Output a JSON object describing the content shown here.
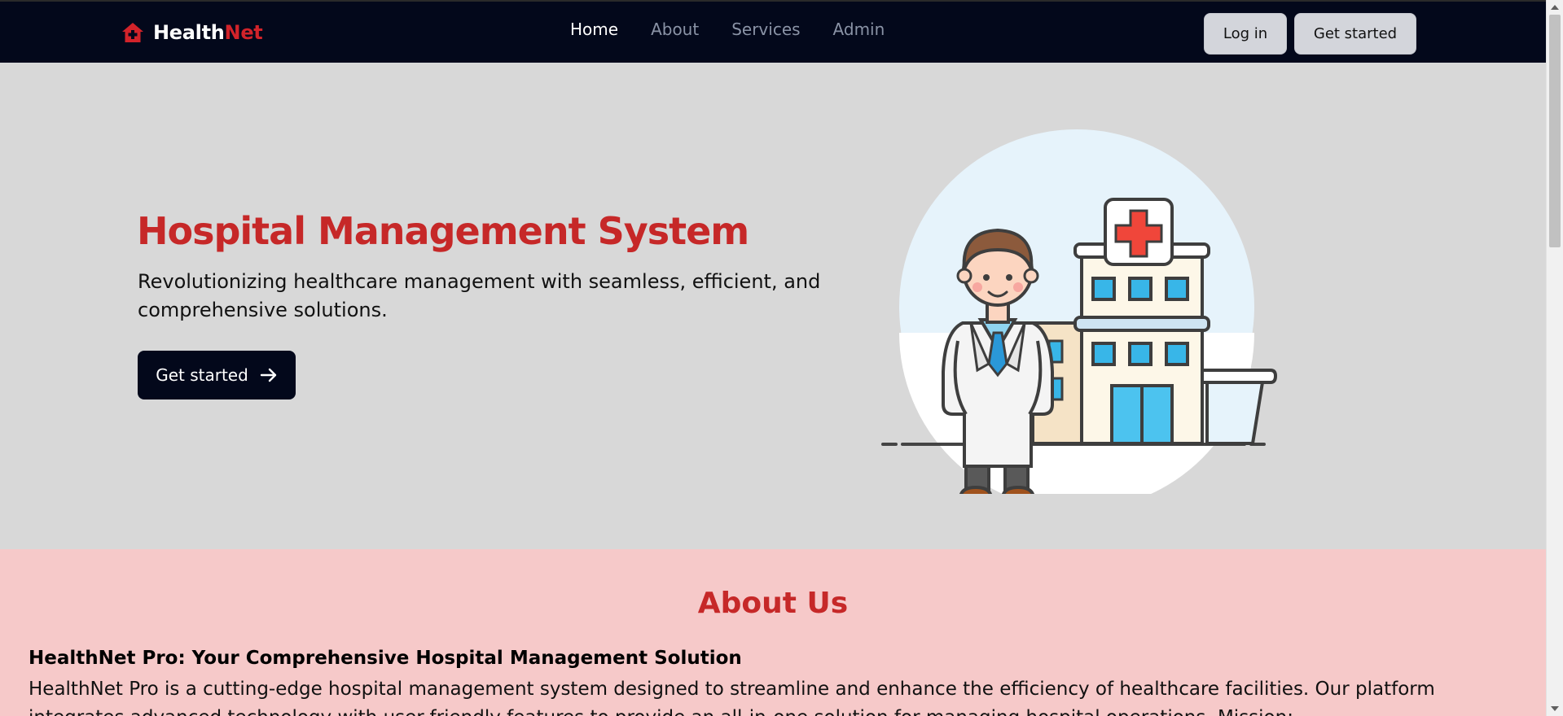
{
  "brand": {
    "name_part1": "Health",
    "name_part2": "Net"
  },
  "nav": {
    "items": [
      {
        "label": "Home",
        "active": true
      },
      {
        "label": "About",
        "active": false
      },
      {
        "label": "Services",
        "active": false
      },
      {
        "label": "Admin",
        "active": false
      }
    ]
  },
  "header_actions": {
    "login_label": "Log in",
    "get_started_label": "Get started"
  },
  "hero": {
    "title": "Hospital Management System",
    "subtitle": "Revolutionizing healthcare management with seamless, efficient, and comprehensive solutions.",
    "cta_label": "Get started",
    "cta_icon": "arrow-right-icon",
    "illustration": "doctor-hospital-illustration"
  },
  "about": {
    "title": "About Us",
    "heading": "HealthNet Pro: Your Comprehensive Hospital Management Solution",
    "text": "HealthNet Pro is a cutting-edge hospital management system designed to streamline and enhance the efficiency of healthcare facilities. Our platform integrates advanced technology with user-friendly features to provide an all-in-one solution for managing hospital operations. Mission:"
  },
  "colors": {
    "nav_bg": "#03081b",
    "accent_red": "#c62828",
    "hero_bg": "#d8d8d8",
    "about_bg": "#f6c9c9"
  }
}
